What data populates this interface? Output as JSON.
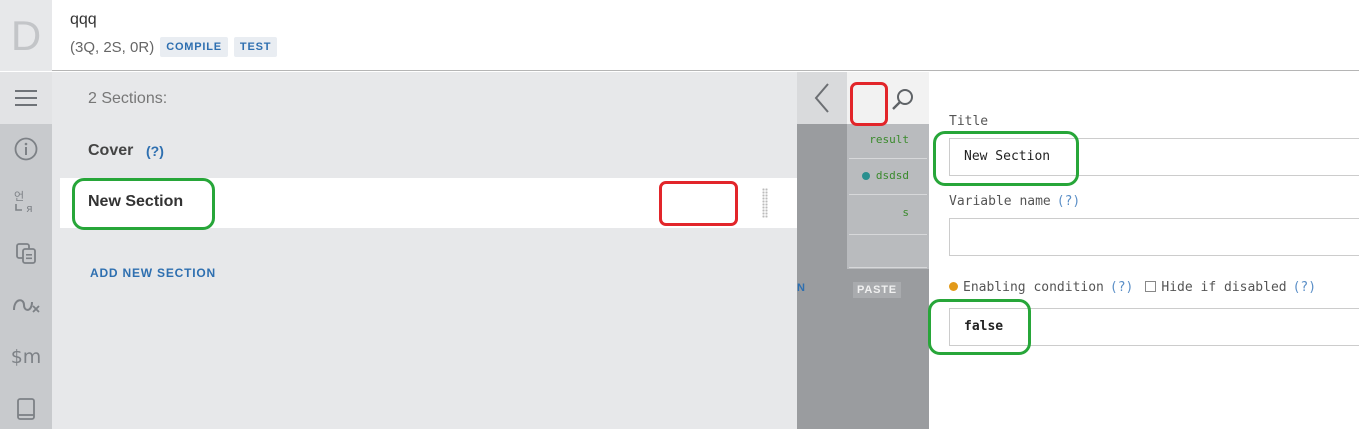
{
  "header": {
    "logo_letter": "D",
    "title": "qqq",
    "subtitle": "(3Q, 2S, 0R)",
    "compile_label": "COMPILE",
    "test_label": "TEST"
  },
  "iconbar": {
    "items": [
      "menu-icon",
      "info-icon",
      "translate-icon",
      "copy-icon",
      "logic-icon",
      "money-icon",
      "book-icon"
    ]
  },
  "sections_panel": {
    "count_label": "2 Sections:",
    "items": [
      {
        "label": "Cover",
        "help": "(?)"
      },
      {
        "label": "New Section"
      }
    ],
    "add_label": "ADD NEW SECTION"
  },
  "midcol": {
    "rows": [
      "result",
      "dsdsd",
      "s"
    ],
    "paste_label": "PASTE",
    "blue_fragment": "N"
  },
  "form": {
    "title_label": "Title",
    "title_value": "New Section",
    "varname_label": "Variable name",
    "varname_help": "(?)",
    "varname_value": "",
    "enabling_label": "Enabling condition",
    "enabling_help": "(?)",
    "hide_label": "Hide if disabled",
    "hide_help": "(?)",
    "enabling_value": "false"
  },
  "colors": {
    "accent": "#2e6fb0",
    "annotation_green": "#27a639",
    "annotation_red": "#e2252a",
    "status_orange": "#e29a1a"
  }
}
